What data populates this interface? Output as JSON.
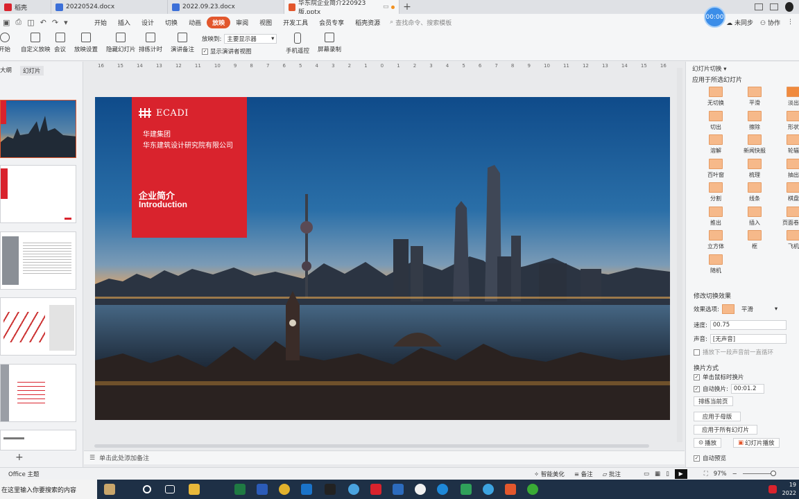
{
  "tabs": [
    {
      "label": "稻壳",
      "color": "#d9232d"
    },
    {
      "label": "20220524.docx",
      "color": "#3b6fd8"
    },
    {
      "label": "2022.09.23.docx",
      "color": "#3b6fd8"
    },
    {
      "label": "华东院企业简介220923版.pptx",
      "color": "#e2572d"
    }
  ],
  "timer": "00:00",
  "menu": [
    "开始",
    "插入",
    "设计",
    "切换",
    "动画",
    "放映",
    "审阅",
    "视图",
    "开发工具",
    "会员专享",
    "稻壳资源"
  ],
  "active_menu": "放映",
  "search_placeholder": "查找命令、搜索模板",
  "menu_right": {
    "sync": "未同步",
    "collab": "协作"
  },
  "toolbar": {
    "start": "开始",
    "custom": "自定义放映",
    "meeting": "会议",
    "settings": "放映设置",
    "hide": "隐藏幻灯片",
    "rehearse": "排练计时",
    "notes": "演讲备注",
    "play_to_label": "放映到:",
    "play_to_value": "主要显示器",
    "presenter_view": "显示演讲者视图",
    "phone": "手机遥控",
    "record": "屏幕录制"
  },
  "left_panel": {
    "outline": "大纲",
    "slides": "幻灯片"
  },
  "ruler": [
    "16",
    "15",
    "14",
    "13",
    "12",
    "11",
    "10",
    "9",
    "8",
    "7",
    "6",
    "5",
    "4",
    "3",
    "2",
    "1",
    "0",
    "1",
    "2",
    "3",
    "4",
    "5",
    "6",
    "7",
    "8",
    "9",
    "10",
    "11",
    "12",
    "13",
    "14",
    "15",
    "16"
  ],
  "slide": {
    "logo_text": "ECADI",
    "group": "华建集团",
    "company": "华东建筑设计研究院有限公司",
    "title": "企业简介",
    "subtitle": "Introduction"
  },
  "notes_placeholder": "单击此处添加备注",
  "right_panel": {
    "header": "幻灯片切换",
    "apply_to": "应用于所选幻灯片",
    "effects": [
      "无切换",
      "平滑",
      "淡出",
      "切出",
      "擦除",
      "形状",
      "溶解",
      "新闻快报",
      "轮辐",
      "百叶窗",
      "梳理",
      "抽出",
      "分割",
      "线条",
      "棋盘",
      "推出",
      "插入",
      "页面卷曲",
      "立方体",
      "框",
      "飞机",
      "随机"
    ],
    "modify": "修改切换效果",
    "effect_option_label": "效果选项:",
    "effect_option_value": "平滑",
    "speed_label": "速度:",
    "speed_value": "00.75",
    "sound_label": "声音:",
    "sound_value": "[无声音]",
    "loop_sound": "播放下一段声音前一直循环",
    "advance": "换片方式",
    "on_click": "单击鼠标时换片",
    "auto_label": "自动换片:",
    "auto_value": "00:01.2",
    "rehearse_current": "排练当前页",
    "apply_master": "应用于母版",
    "apply_all": "应用于所有幻灯片",
    "play": "播放",
    "slideshow": "幻灯片播放",
    "auto_preview": "自动预览"
  },
  "status": {
    "theme": "Office 主题",
    "beautify": "智能美化",
    "notes": "备注",
    "comment": "批注",
    "zoom": "97%"
  },
  "taskbar": {
    "search": "在这里输入你要搜索的内容",
    "time": "19",
    "date": "2022"
  }
}
